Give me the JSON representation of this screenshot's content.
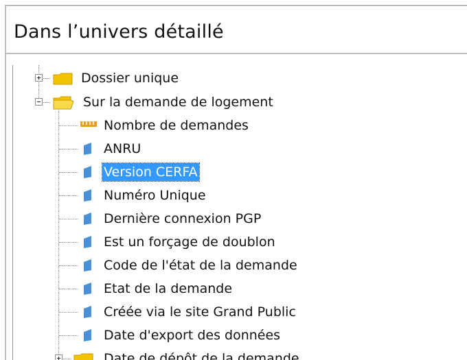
{
  "header": {
    "title": "Dans l’univers détaillé"
  },
  "tree": {
    "items": [
      {
        "label": "Dossier unique",
        "icon": "folder-closed-icon",
        "expander": "plus",
        "level": 0
      },
      {
        "label": "Sur la demande de logement",
        "icon": "folder-open-icon",
        "expander": "minus",
        "level": 0
      },
      {
        "label": "Nombre de demandes",
        "icon": "measure-icon",
        "level": 1
      },
      {
        "label": "ANRU",
        "icon": "dimension-icon",
        "level": 1
      },
      {
        "label": "Version CERFA",
        "icon": "dimension-icon",
        "level": 1,
        "selected": true
      },
      {
        "label": "Numéro Unique",
        "icon": "dimension-icon",
        "level": 1
      },
      {
        "label": "Dernière connexion PGP",
        "icon": "dimension-icon",
        "level": 1
      },
      {
        "label": "Est un forçage de doublon",
        "icon": "dimension-icon",
        "level": 1
      },
      {
        "label": "Code de l'état de la demande",
        "icon": "dimension-icon",
        "level": 1
      },
      {
        "label": "Etat de la demande",
        "icon": "dimension-icon",
        "level": 1
      },
      {
        "label": "Créée via le site Grand Public",
        "icon": "dimension-icon",
        "level": 1
      },
      {
        "label": "Date d'export des données",
        "icon": "dimension-icon",
        "level": 1
      },
      {
        "label": "Date de dépôt de la demande",
        "icon": "folder-closed-icon",
        "expander": "plus",
        "level": 1
      }
    ]
  },
  "colors": {
    "selection": "#3399ff",
    "folder": "#f5c400",
    "dimension": "#4a90d9",
    "measure": "#e8a020"
  }
}
